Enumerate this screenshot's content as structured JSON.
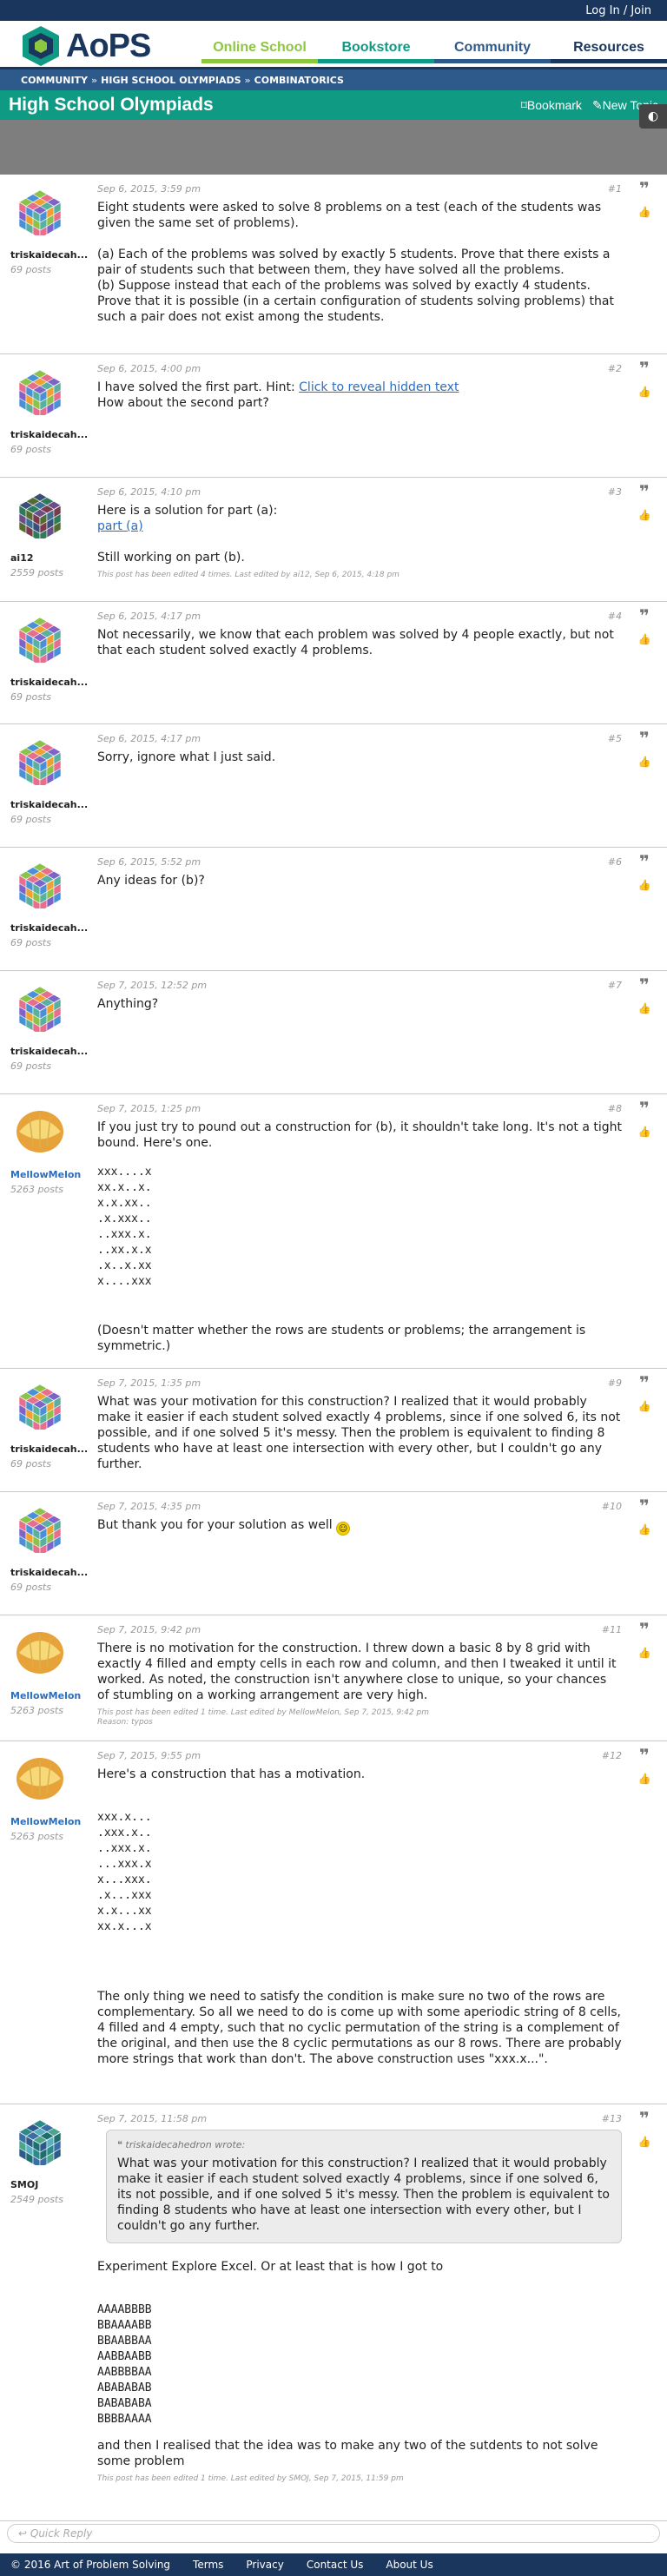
{
  "top_bar": {
    "login": "Log In / Join"
  },
  "header": {
    "logo_text": "AoPS",
    "nav": [
      {
        "label": "Online School",
        "color": "#8dc63f"
      },
      {
        "label": "Bookstore",
        "color": "#0f9a84"
      },
      {
        "label": "Community",
        "color": "#2d5a8a"
      },
      {
        "label": "Resources",
        "color": "#1b365d"
      }
    ]
  },
  "breadcrumb": [
    "COMMUNITY",
    "HIGH SCHOOL OLYMPIADS",
    "COMBINATORICS"
  ],
  "breadcrumb_sep": "»",
  "forum": {
    "title": "High School Olympiads",
    "bookmark": "Bookmark",
    "new_topic": "New Topic"
  },
  "posts": [
    {
      "num": "#1",
      "date": "Sep 6, 2015, 3:59 pm",
      "user": "triskaidecah...",
      "posts": "69 posts",
      "avatar": "cube-avatar",
      "text": "Eight students were asked to solve 8 problems on a test (each of the students was given the same set of problems).\n\n(a) Each of the problems was solved by exactly 5 students. Prove that there exists a pair of students such that between them, they have solved all the problems.\n(b) Suppose instead that each of the problems was solved by exactly 4 students. Prove that it is possible (in a certain configuration of students solving problems) that such a pair does not exist among the students."
    },
    {
      "num": "#2",
      "date": "Sep 6, 2015, 4:00 pm",
      "user": "triskaidecah...",
      "posts": "69 posts",
      "avatar": "cube-avatar",
      "text_before": "I have solved the first part. Hint: ",
      "link": "Click to reveal hidden text",
      "text_after": "How about the second part?"
    },
    {
      "num": "#3",
      "date": "Sep 6, 2015, 4:10 pm",
      "user": "ai12",
      "posts": "2559 posts",
      "avatar": "dark-cube-avatar",
      "text_before": "Here is a solution for part (a):",
      "link": "part (a)",
      "text_after": "Still working on part (b).",
      "note": "This post has been edited 4 times. Last edited by ai12, Sep 6, 2015, 4:18 pm"
    },
    {
      "num": "#4",
      "date": "Sep 6, 2015, 4:17 pm",
      "user": "triskaidecah...",
      "posts": "69 posts",
      "avatar": "cube-avatar",
      "text": "Not necessarily, we know that each problem was solved by 4 people exactly, but not that each student solved exactly 4 problems."
    },
    {
      "num": "#5",
      "date": "Sep 6, 2015, 4:17 pm",
      "user": "triskaidecah...",
      "posts": "69 posts",
      "avatar": "cube-avatar",
      "text": "Sorry, ignore what I just said."
    },
    {
      "num": "#6",
      "date": "Sep 6, 2015, 5:52 pm",
      "user": "triskaidecah...",
      "posts": "69 posts",
      "avatar": "cube-avatar",
      "text": "Any ideas for (b)?"
    },
    {
      "num": "#7",
      "date": "Sep 7, 2015, 12:52 pm",
      "user": "triskaidecah...",
      "posts": "69 posts",
      "avatar": "cube-avatar",
      "text": "Anything?"
    },
    {
      "num": "#8",
      "date": "Sep 7, 2015, 1:25 pm",
      "user": "MellowMelon",
      "posts": "5263 posts",
      "avatar": "melon-avatar",
      "text": "If you just try to pound out a construction for (b), it shouldn't take long. It's not a tight bound. Here's one.",
      "grid": "xxx....x\nxx.x..x.\nx.x.xx..\n.x.xxx..\n..xxx.x.\n..xx.x.x\n.x..x.xx\nx....xxx",
      "text_after": "(Doesn't matter whether the rows are students or problems; the arrangement is symmetric.)"
    },
    {
      "num": "#9",
      "date": "Sep 7, 2015, 1:35 pm",
      "user": "triskaidecah...",
      "posts": "69 posts",
      "avatar": "cube-avatar",
      "text": "What was your motivation for this construction? I realized that it would probably make it easier if each student solved exactly 4 problems, since if one solved 6, its not possible, and if one solved 5 it's messy. Then the problem is equivalent to finding 8 students who have at least one intersection with every other, but I couldn't go any further."
    },
    {
      "num": "#10",
      "date": "Sep 7, 2015, 4:35 pm",
      "user": "triskaidecah...",
      "posts": "69 posts",
      "avatar": "cube-avatar",
      "text": "But thank you for your solution as well "
    },
    {
      "num": "#11",
      "date": "Sep 7, 2015, 9:42 pm",
      "user": "MellowMelon",
      "posts": "5263 posts",
      "avatar": "melon-avatar",
      "text": "There is no motivation for the construction. I threw down a basic 8 by 8 grid with exactly 4 filled and empty cells in each row and column, and then I tweaked it until it worked. As noted, the construction isn't anywhere close to unique, so your chances of stumbling on a working arrangement are very high.",
      "note": "This post has been edited 1 time. Last edited by MellowMelon, Sep 7, 2015, 9:42 pm\nReason: typos"
    },
    {
      "num": "#12",
      "date": "Sep 7, 2015, 9:55 pm",
      "user": "MellowMelon",
      "posts": "5263 posts",
      "avatar": "melon-avatar",
      "text": "Here's a construction that has a motivation.",
      "grid": "xxx.x...\n.xxx.x..\n..xxx.x.\n...xxx.x\nx...xxx.\n.x...xxx\nx.x...xx\nxx.x...x",
      "text_after": "The only thing we need to satisfy the condition is make sure no two of the rows are complementary. So all we need to do is come up with some aperiodic string of 8 cells, 4 filled and 4 empty, such that no cyclic permutation of the string is a complement of the original, and then use the 8 cyclic permutations as our 8 rows. There are probably more strings that work than don't. The above construction uses \"xxx.x...\"."
    },
    {
      "num": "#13",
      "date": "Sep 7, 2015, 11:58 pm",
      "user": "SMOJ",
      "posts": "2549 posts",
      "avatar": "teal-cube-avatar",
      "quote_author": "triskaidecahedron wrote:",
      "quote": "What was your motivation for this construction? I realized that it would probably make it easier if each student solved exactly 4 problems, since if one solved 6, its not possible, and if one solved 5 it's messy. Then the problem is equivalent to finding 8 students who have at least one intersection with every other, but I couldn't go any further.",
      "text": "Experiment Explore Excel. Or at least that is how I got to",
      "grid": "AAAABBBB\nBBAAAABB\nBBAABBAA\nAABBAABB\nAABBBBAA\nABABABAB\nBABABABA\nBBBBAAAA",
      "text_after": "and then I realised that the idea was to make any two of the sutdents to not solve some problem",
      "note": "This post has been edited 1 time. Last edited by SMOJ, Sep 7, 2015, 11:59 pm"
    }
  ],
  "quick_reply": {
    "placeholder": "Quick Reply"
  },
  "footer": {
    "copyright": "© 2016 Art of Problem Solving",
    "links": [
      "Terms",
      "Privacy",
      "Contact Us",
      "About Us"
    ]
  }
}
